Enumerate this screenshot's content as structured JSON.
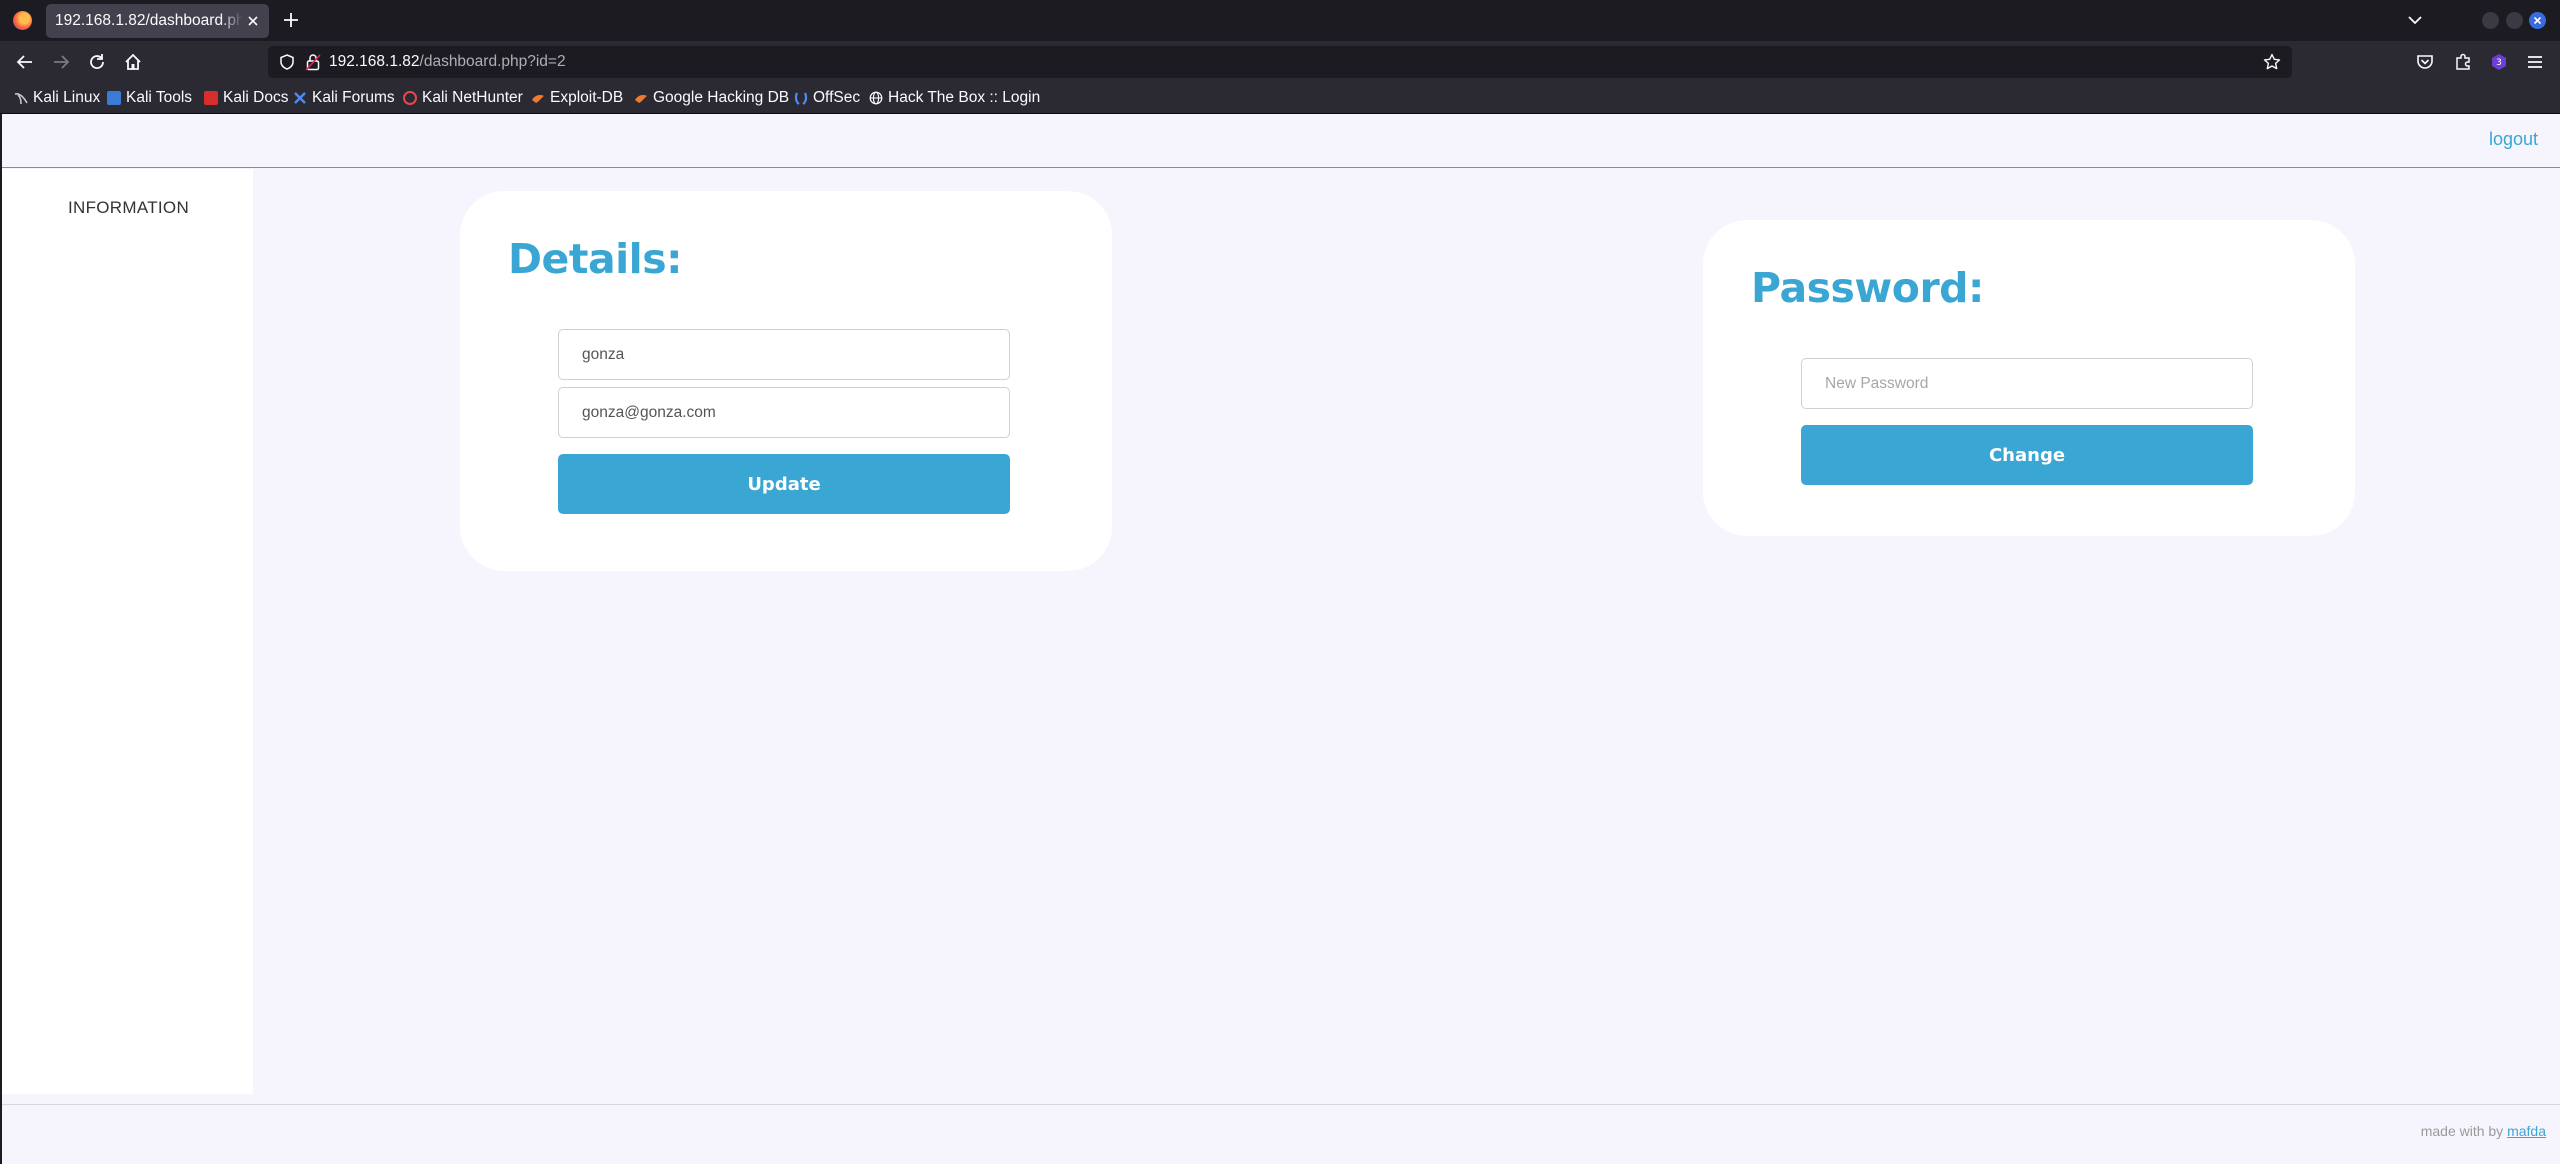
{
  "browser": {
    "tab_title": "192.168.1.82/dashboard.php?id=2",
    "url_host": "192.168.1.82",
    "url_path": "/dashboard.php?id=2",
    "bookmarks": [
      {
        "label": "Kali Linux",
        "icon": "kali-icon"
      },
      {
        "label": "Kali Tools",
        "icon": "kali-tools-icon"
      },
      {
        "label": "Kali Docs",
        "icon": "kali-docs-icon"
      },
      {
        "label": "Kali Forums",
        "icon": "kali-forums-icon"
      },
      {
        "label": "Kali NetHunter",
        "icon": "nethunter-icon"
      },
      {
        "label": "Exploit-DB",
        "icon": "exploit-db-icon"
      },
      {
        "label": "Google Hacking DB",
        "icon": "ghdb-icon"
      },
      {
        "label": "OffSec",
        "icon": "offsec-icon"
      },
      {
        "label": "Hack The Box :: Login",
        "icon": "globe-icon"
      }
    ],
    "extension_badge": "3"
  },
  "header": {
    "logout_label": "logout"
  },
  "sidebar": {
    "items": [
      {
        "label": "INFORMATION"
      }
    ]
  },
  "details": {
    "title": "Details:",
    "username_value": "gonza",
    "email_value": "gonza@gonza.com",
    "update_label": "Update"
  },
  "password": {
    "title": "Password:",
    "new_password_placeholder": "New Password",
    "change_label": "Change"
  },
  "footer": {
    "prefix": "made with by",
    "author": "mafda"
  },
  "colors": {
    "accent": "#3aa6d4",
    "page_bg": "#f6f5fd",
    "card_bg": "#ffffff"
  }
}
